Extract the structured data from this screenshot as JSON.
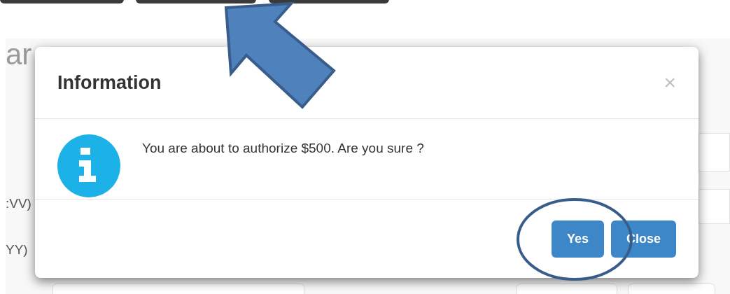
{
  "page": {
    "heading": "ar",
    "labels": [
      ":VV)",
      "YY)"
    ]
  },
  "dialog": {
    "title": "Information",
    "close": "×",
    "message": "You are about to authorize $500. Are you sure ?",
    "buttons": [
      {
        "label": "Yes",
        "circled": true
      },
      {
        "label": "Close",
        "circled": false
      }
    ]
  }
}
